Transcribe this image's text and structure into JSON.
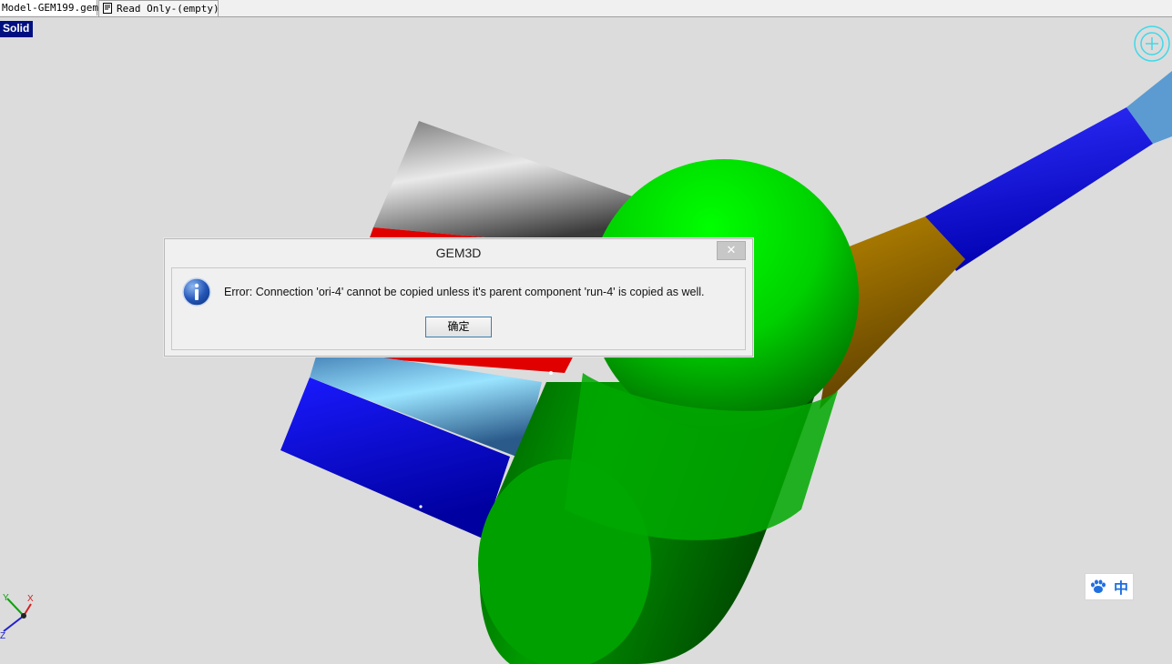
{
  "tabs": [
    {
      "label": "Model-GEM199.gem"
    },
    {
      "label": "Read Only-(empty)"
    }
  ],
  "viewport": {
    "mode_label": "Solid"
  },
  "dialog": {
    "title": "GEM3D",
    "close_glyph": "✕",
    "message": "Error: Connection 'ori-4' cannot be copied unless it's parent component 'run-4' is copied as well.",
    "ok_label": "确定",
    "icon": "info-icon"
  },
  "ime": {
    "icon": "paw-icon",
    "lang_label": "中"
  },
  "axis": {
    "x_label": "X",
    "y_label": "Y",
    "z_label": "Z"
  },
  "colors": {
    "accent": "#001080",
    "sphere": "#00c000",
    "pipe_blue": "#0000ee",
    "pipe_brown": "#a07000"
  }
}
